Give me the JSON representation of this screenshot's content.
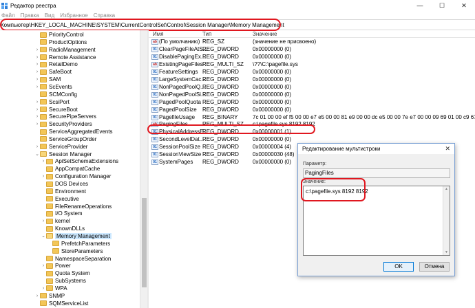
{
  "window": {
    "title": "Редактор реестра",
    "buttons": [
      "—",
      "☐",
      "✕"
    ]
  },
  "menu": [
    "Файл",
    "Правка",
    "Вид",
    "Избранное",
    "Справка"
  ],
  "address": "Компьютер\\HKEY_LOCAL_MACHINE\\SYSTEM\\CurrentControlSet\\Control\\Session Manager\\Memory Management",
  "tree": {
    "items": [
      {
        "label": "PriorityControl",
        "exp": ""
      },
      {
        "label": "ProductOptions",
        "exp": ""
      },
      {
        "label": "RadioManagement",
        "exp": "›"
      },
      {
        "label": "Remote Assistance",
        "exp": "›"
      },
      {
        "label": "RetailDemo",
        "exp": "›"
      },
      {
        "label": "SafeBoot",
        "exp": "›"
      },
      {
        "label": "SAM",
        "exp": "›"
      },
      {
        "label": "ScEvents",
        "exp": "›"
      },
      {
        "label": "SCMConfig",
        "exp": ""
      },
      {
        "label": "ScsiPort",
        "exp": "›"
      },
      {
        "label": "SecureBoot",
        "exp": "›"
      },
      {
        "label": "SecurePipeServers",
        "exp": "›"
      },
      {
        "label": "SecurityProviders",
        "exp": "›"
      },
      {
        "label": "ServiceAggregatedEvents",
        "exp": ""
      },
      {
        "label": "ServiceGroupOrder",
        "exp": ""
      },
      {
        "label": "ServiceProvider",
        "exp": "›"
      },
      {
        "label": "Session Manager",
        "exp": "⌄"
      },
      {
        "label": "ApiSetSchemaExtensions",
        "exp": "›"
      },
      {
        "label": "AppCompatCache",
        "exp": ""
      },
      {
        "label": "Configuration Manager",
        "exp": "›"
      },
      {
        "label": "DOS Devices",
        "exp": ""
      },
      {
        "label": "Environment",
        "exp": ""
      },
      {
        "label": "Executive",
        "exp": ""
      },
      {
        "label": "FileRenameOperations",
        "exp": ""
      },
      {
        "label": "I/O System",
        "exp": ""
      },
      {
        "label": "kernel",
        "exp": "›"
      },
      {
        "label": "KnownDLLs",
        "exp": ""
      },
      {
        "label": "Memory Management",
        "exp": "⌄"
      },
      {
        "label": "PrefetchParameters",
        "exp": ""
      },
      {
        "label": "StoreParameters",
        "exp": ""
      },
      {
        "label": "NamespaceSeparation",
        "exp": ""
      },
      {
        "label": "Power",
        "exp": "›"
      },
      {
        "label": "Quota System",
        "exp": ""
      },
      {
        "label": "SubSystems",
        "exp": ""
      },
      {
        "label": "WPA",
        "exp": "›"
      },
      {
        "label": "SNMP",
        "exp": "›"
      },
      {
        "label": "SQMServiceList",
        "exp": ""
      },
      {
        "label": "Srp",
        "exp": "›"
      }
    ]
  },
  "list": {
    "headers": {
      "name": "Имя",
      "type": "Тип",
      "data": "Значение"
    },
    "rows": [
      {
        "icon": "ab",
        "name": "(По умолчанию)",
        "type": "REG_SZ",
        "data": "(значение не присвоено)"
      },
      {
        "icon": "01",
        "name": "ClearPageFileAtS...",
        "type": "REG_DWORD",
        "data": "0x00000000 (0)"
      },
      {
        "icon": "01",
        "name": "DisablePagingEx...",
        "type": "REG_DWORD",
        "data": "0x00000000 (0)"
      },
      {
        "icon": "ab",
        "name": "ExistingPageFiles",
        "type": "REG_MULTI_SZ",
        "data": "\\??\\C:\\pagefile.sys"
      },
      {
        "icon": "01",
        "name": "FeatureSettings",
        "type": "REG_DWORD",
        "data": "0x00000000 (0)"
      },
      {
        "icon": "01",
        "name": "LargeSystemCac...",
        "type": "REG_DWORD",
        "data": "0x00000000 (0)"
      },
      {
        "icon": "01",
        "name": "NonPagedPoolQ...",
        "type": "REG_DWORD",
        "data": "0x00000000 (0)"
      },
      {
        "icon": "01",
        "name": "NonPagedPoolSi...",
        "type": "REG_DWORD",
        "data": "0x00000000 (0)"
      },
      {
        "icon": "01",
        "name": "PagedPoolQuota",
        "type": "REG_DWORD",
        "data": "0x00000000 (0)"
      },
      {
        "icon": "01",
        "name": "PagedPoolSize",
        "type": "REG_DWORD",
        "data": "0x00000000 (0)"
      },
      {
        "icon": "01",
        "name": "PagefileUsage",
        "type": "REG_BINARY",
        "data": "7c 01 00 00 ef f5 00 00 e7 e5 00 00 81 e9 00 00 dc e5 00 00 7e e7 00 00 09 69 01 00 c9 67 0..."
      },
      {
        "icon": "ab",
        "name": "PagingFiles",
        "type": "REG_MULTI_SZ",
        "data": "c:\\pagefile.sys 8192 8192"
      },
      {
        "icon": "01",
        "name": "PhysicalAddressE...",
        "type": "REG_DWORD",
        "data": "0x00000001 (1)"
      },
      {
        "icon": "01",
        "name": "SecondLevelDat...",
        "type": "REG_DWORD",
        "data": "0x00000000 (0)"
      },
      {
        "icon": "01",
        "name": "SessionPoolSize",
        "type": "REG_DWORD",
        "data": "0x00000004 (4)"
      },
      {
        "icon": "01",
        "name": "SessionViewSize",
        "type": "REG_DWORD",
        "data": "0x00000030 (48)"
      },
      {
        "icon": "01",
        "name": "SystemPages",
        "type": "REG_DWORD",
        "data": "0x00000000 (0)"
      }
    ]
  },
  "dialog": {
    "title": "Редактирование мультистроки",
    "param_label": "Параметр:",
    "param_value": "PagingFiles",
    "value_label": "Значение:",
    "value_text": "c:\\pagefile.sys 8192 8192",
    "ok": "OK",
    "cancel": "Отмена",
    "close": "✕"
  }
}
